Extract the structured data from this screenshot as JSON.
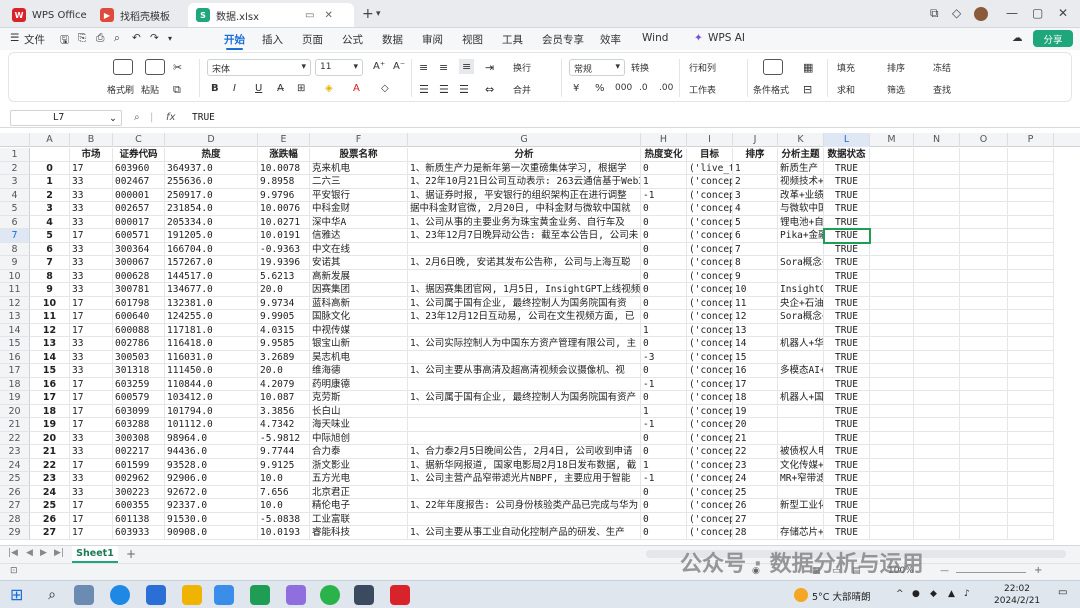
{
  "tabs": [
    {
      "label": "WPS Office"
    },
    {
      "label": "找稻壳模板"
    },
    {
      "label": "数据.xlsx"
    }
  ],
  "menu": {
    "file": "文件",
    "items": [
      "开始",
      "插入",
      "页面",
      "公式",
      "数据",
      "审阅",
      "视图",
      "工具",
      "会员专享",
      "效率",
      "Wind"
    ],
    "ai": "WPS AI",
    "share": "分享"
  },
  "ribbon": {
    "format_painter": "格式刷",
    "paste": "粘贴",
    "font": "宋体",
    "font_size": "11",
    "wrap": "换行",
    "merge": "合并",
    "number_format": "常规",
    "convert": "转换",
    "rows_cols": "行和列",
    "worksheet": "工作表",
    "cond_format": "条件格式",
    "fill": "填充",
    "sort": "排序",
    "freeze": "冻结",
    "sum": "求和",
    "filter": "筛选",
    "find": "查找"
  },
  "formula_bar": {
    "cell_ref": "L7",
    "fx": "fx",
    "value": "TRUE"
  },
  "columns": [
    "A",
    "B",
    "C",
    "D",
    "E",
    "F",
    "G",
    "H",
    "I",
    "J",
    "K",
    "L",
    "M",
    "N",
    "O",
    "P"
  ],
  "headers": [
    "",
    "市场",
    "证券代码",
    "热度",
    "涨跌幅",
    "股票名称",
    "分析",
    "热度变化",
    "目标",
    "排序",
    "分析主题",
    "数据状态"
  ],
  "rows": [
    [
      "0",
      "17",
      "603960",
      "364937.0",
      "10.0078",
      "克来机电",
      "1、新质生产力是新年第一次重磅集体学习, 根据学",
      "0",
      "('live_t",
      "1",
      "新质生产",
      "TRUE"
    ],
    [
      "1",
      "33",
      "002467",
      "255636.0",
      "9.8958",
      "二六三",
      "1、22年10月21日公司互动表示: 263云通信基于Web3",
      "1",
      "('concept",
      "2",
      "视频技术+",
      "TRUE"
    ],
    [
      "2",
      "33",
      "000001",
      "250917.0",
      "9.9796",
      "平安银行",
      "1、据证券时报, 平安银行的组织架构正在进行调整",
      "-1",
      "('concept",
      "3",
      "改革+业绩",
      "TRUE"
    ],
    [
      "3",
      "33",
      "002657",
      "231854.0",
      "10.0076",
      "中科金财",
      "据中科金财官微, 2月20日, 中科金财与微软中国就",
      "0",
      "('concept",
      "4",
      "与微软中国",
      "TRUE"
    ],
    [
      "4",
      "33",
      "000017",
      "205334.0",
      "10.0271",
      "深中华A",
      "1、公司从事的主要业务为珠宝黄金业务、自行车及",
      "0",
      "('concept",
      "5",
      "锂电池+自",
      "TRUE"
    ],
    [
      "5",
      "17",
      "600571",
      "191205.0",
      "10.0191",
      "信雅达",
      "1、23年12月7日晚异动公告: 截至本公告日, 公司未",
      "0",
      "('concept",
      "6",
      "Pika+金融",
      "TRUE"
    ],
    [
      "6",
      "33",
      "300364",
      "166704.0",
      "-0.9363",
      "中文在线",
      "",
      "0",
      "('concept",
      "7",
      "",
      "TRUE"
    ],
    [
      "7",
      "33",
      "300067",
      "157267.0",
      "19.9396",
      "安诺其",
      "1、2月6日晚, 安诺其发布公告称, 公司与上海互聪",
      "0",
      "('concept",
      "8",
      "Sora概念+",
      "TRUE"
    ],
    [
      "8",
      "33",
      "000628",
      "144517.0",
      "5.6213",
      "高新发展",
      "",
      "0",
      "('concept",
      "9",
      "",
      "TRUE"
    ],
    [
      "9",
      "33",
      "300781",
      "134677.0",
      "20.0",
      "因赛集团",
      "1、据因赛集团官网, 1月5日, InsightGPT上线视频",
      "0",
      "('concept",
      "10",
      "InsightGP",
      "TRUE"
    ],
    [
      "10",
      "17",
      "601798",
      "132381.0",
      "9.9734",
      "蓝科高新",
      "1、公司属于国有企业, 最终控制人为国务院国有资",
      "0",
      "('concept",
      "11",
      "央企+石油",
      "TRUE"
    ],
    [
      "11",
      "17",
      "600640",
      "124255.0",
      "9.9905",
      "国脉文化",
      "1、23年12月12日互动易, 公司在文生视频方面, 已",
      "0",
      "('concept",
      "12",
      "Sora概念+",
      "TRUE"
    ],
    [
      "12",
      "17",
      "600088",
      "117181.0",
      "4.0315",
      "中视传媒",
      "",
      "1",
      "('concept",
      "13",
      "",
      "TRUE"
    ],
    [
      "13",
      "33",
      "002786",
      "116418.0",
      "9.9585",
      "银宝山新",
      "1、公司实际控制人为中国东方资产管理有限公司, 主",
      "0",
      "('concept",
      "14",
      "机器人+华",
      "TRUE"
    ],
    [
      "14",
      "33",
      "300503",
      "116031.0",
      "3.2689",
      "昊志机电",
      "",
      "-3",
      "('concept",
      "15",
      "",
      "TRUE"
    ],
    [
      "15",
      "33",
      "301318",
      "111450.0",
      "20.0",
      "维海德",
      "1、公司主要从事高清及超高清视频会议摄像机、视",
      "0",
      "('concept",
      "16",
      "多模态AI+",
      "TRUE"
    ],
    [
      "16",
      "17",
      "603259",
      "110844.0",
      "4.2079",
      "药明康德",
      "",
      "-1",
      "('concept",
      "17",
      "",
      "TRUE"
    ],
    [
      "17",
      "17",
      "600579",
      "103412.0",
      "10.087",
      "克劳斯",
      "1、公司属于国有企业, 最终控制人为国务院国有资产",
      "0",
      "('concept",
      "18",
      "机器人+国",
      "TRUE"
    ],
    [
      "18",
      "17",
      "603099",
      "101794.0",
      "3.3856",
      "长白山",
      "",
      "1",
      "('concept",
      "19",
      "",
      "TRUE"
    ],
    [
      "19",
      "17",
      "603288",
      "101112.0",
      "4.7342",
      "海天味业",
      "",
      "-1",
      "('concept",
      "20",
      "",
      "TRUE"
    ],
    [
      "20",
      "33",
      "300308",
      "98964.0",
      "-5.9812",
      "中际旭创",
      "",
      "0",
      "('concept",
      "21",
      "",
      "TRUE"
    ],
    [
      "21",
      "33",
      "002217",
      "94436.0",
      "9.7744",
      "合力泰",
      "1、合力泰2月5日晚间公告, 2月4日, 公司收到申请",
      "0",
      "('concept",
      "22",
      "被债权人申",
      "TRUE"
    ],
    [
      "22",
      "17",
      "601599",
      "93528.0",
      "9.9125",
      "浙文影业",
      "1、据新华网报道, 国家电影局2月18日发布数据, 截",
      "1",
      "('concept",
      "23",
      "文化传媒+",
      "TRUE"
    ],
    [
      "23",
      "33",
      "002962",
      "92906.0",
      "10.0",
      "五方光电",
      "1、公司主营产品窄带滤光片NBPF, 主要应用于智能",
      "-1",
      "('concept",
      "24",
      "MR+窄带滤",
      "TRUE"
    ],
    [
      "24",
      "33",
      "300223",
      "92672.0",
      "7.656",
      "北京君正",
      "",
      "0",
      "('concept",
      "25",
      "",
      "TRUE"
    ],
    [
      "25",
      "17",
      "600355",
      "92337.0",
      "10.0",
      "精伦电子",
      "1、22年年度报告: 公司身份核验类产品已完成与华为",
      "0",
      "('concept",
      "26",
      "新型工业化",
      "TRUE"
    ],
    [
      "26",
      "17",
      "601138",
      "91530.0",
      "-5.0838",
      "工业富联",
      "",
      "0",
      "('concept",
      "27",
      "",
      "TRUE"
    ],
    [
      "27",
      "17",
      "603933",
      "90908.0",
      "10.0193",
      "睿能科技",
      "1、公司主要从事工业自动化控制产品的研发、生产",
      "0",
      "('concept",
      "28",
      "存储芯片+",
      "TRUE"
    ]
  ],
  "sheet": {
    "name": "Sheet1"
  },
  "status": {
    "zoom": "100%"
  },
  "taskbar": {
    "weather": "5°C 大部晴朗",
    "time": "22:02",
    "date": "2024/2/21"
  },
  "watermark": "公众号 · 数据分析与运用"
}
